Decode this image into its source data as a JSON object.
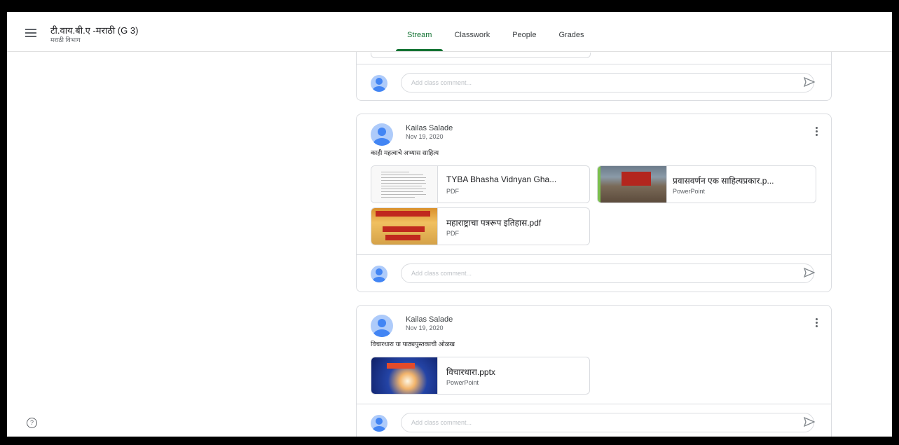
{
  "header": {
    "class_title": "टी.वाय.बी.ए -मराठी (G 3)",
    "class_subtitle": "मराठी विभाग",
    "tabs": [
      "Stream",
      "Classwork",
      "People",
      "Grades"
    ],
    "active_tab": "Stream"
  },
  "comment_placeholder": "Add class comment...",
  "posts": [
    {
      "author": "Kailas Salade",
      "date": "Nov 19, 2020",
      "text": "काही महत्वाचे अभ्यास साहित्य",
      "attachments": [
        {
          "title": "TYBA Bhasha Vidnyan Gha...",
          "type": "PDF"
        },
        {
          "title": "प्रवासवर्णन एक साहित्यप्रकार.p...",
          "type": "PowerPoint"
        },
        {
          "title": "महाराष्ट्राचा पत्ररूप इतिहास.pdf",
          "type": "PDF"
        }
      ]
    },
    {
      "author": "Kailas Salade",
      "date": "Nov 19, 2020",
      "text": "विचारधारा या पाठ्यपुस्तकाची ओळख",
      "attachments": [
        {
          "title": "विचारधारा.pptx",
          "type": "PowerPoint"
        }
      ]
    }
  ],
  "help_icon_glyph": "?",
  "colors": {
    "accent_green": "#137333",
    "avatar_blue": "#4285f4",
    "border": "#dadce0"
  }
}
